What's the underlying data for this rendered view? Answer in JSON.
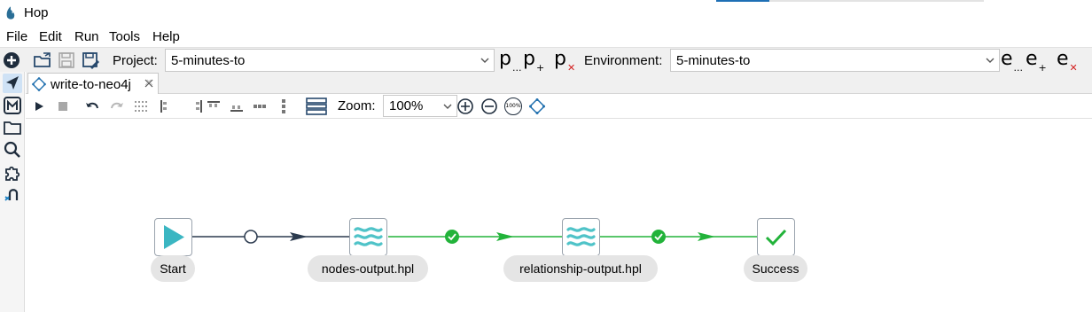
{
  "window": {
    "title": "Hop"
  },
  "menu": {
    "items": [
      "File",
      "Edit",
      "Run",
      "Tools",
      "Help"
    ]
  },
  "toolbar": {
    "project_label": "Project:",
    "project_value": "5-minutes-to",
    "environment_label": "Environment:",
    "environment_value": "5-minutes-to",
    "project_buttons": [
      "p",
      "p",
      "p"
    ],
    "environment_buttons": [
      "e",
      "e",
      "e"
    ]
  },
  "tab": {
    "label": "write-to-neo4j"
  },
  "canvas_toolbar": {
    "zoom_label": "Zoom:",
    "zoom_value": "100%",
    "zoom_100_badge": "100%"
  },
  "workflow": {
    "nodes": [
      {
        "name": "Start",
        "icon": "play-icon"
      },
      {
        "name": "nodes-output.hpl",
        "icon": "pipeline-waves-icon"
      },
      {
        "name": "relationship-output.hpl",
        "icon": "pipeline-waves-icon"
      },
      {
        "name": "Success",
        "icon": "checkmark-icon"
      }
    ],
    "hops": [
      {
        "from": "Start",
        "to": "nodes-output.hpl",
        "type": "unconditional"
      },
      {
        "from": "nodes-output.hpl",
        "to": "relationship-output.hpl",
        "type": "success"
      },
      {
        "from": "relationship-output.hpl",
        "to": "Success",
        "type": "success"
      }
    ]
  },
  "colors": {
    "accent": "#1e6fb5",
    "success_green": "#22b33a",
    "start_teal": "#3bb6c2",
    "hop_dark": "#2b3a4e"
  }
}
